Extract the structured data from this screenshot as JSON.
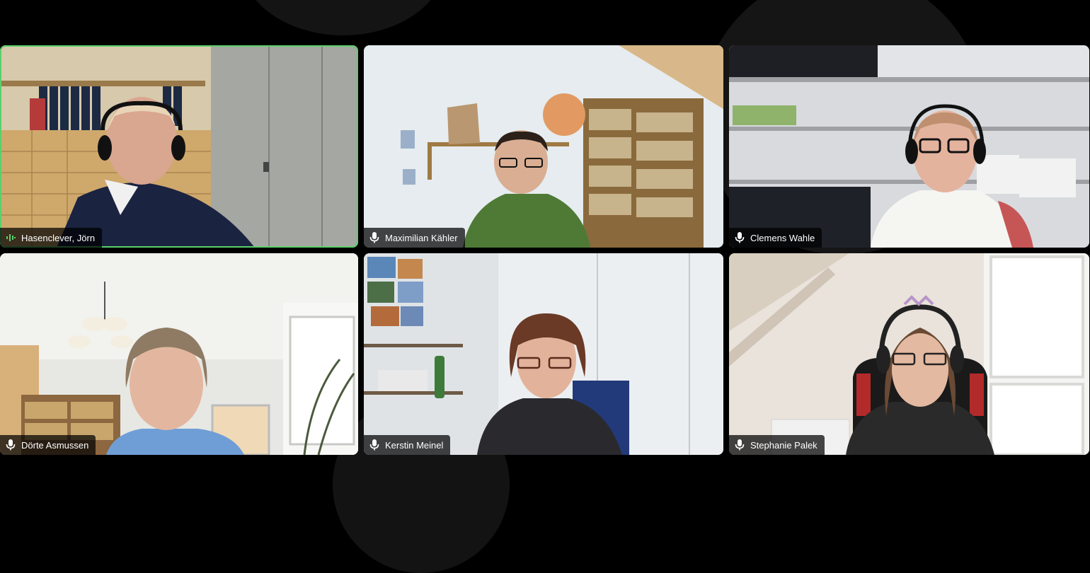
{
  "meeting": {
    "participants": [
      {
        "name": "Hasenclever, Jörn",
        "status_icon": "speaking-indicator-icon",
        "active_speaker": true
      },
      {
        "name": "Maximilian Kähler",
        "status_icon": "mic-icon",
        "active_speaker": false
      },
      {
        "name": "Clemens Wahle",
        "status_icon": "mic-icon",
        "active_speaker": false
      },
      {
        "name": "Dörte Asmussen",
        "status_icon": "mic-icon",
        "active_speaker": false
      },
      {
        "name": "Kerstin Meinel",
        "status_icon": "mic-icon",
        "active_speaker": false
      },
      {
        "name": "Stephanie Palek",
        "status_icon": "mic-icon",
        "active_speaker": false
      }
    ],
    "colors": {
      "background": "#000000",
      "active_speaker_border": "#5ad06b",
      "name_tag_bg": "rgba(0,0,0,0.72)",
      "name_tag_text": "#ffffff"
    }
  }
}
